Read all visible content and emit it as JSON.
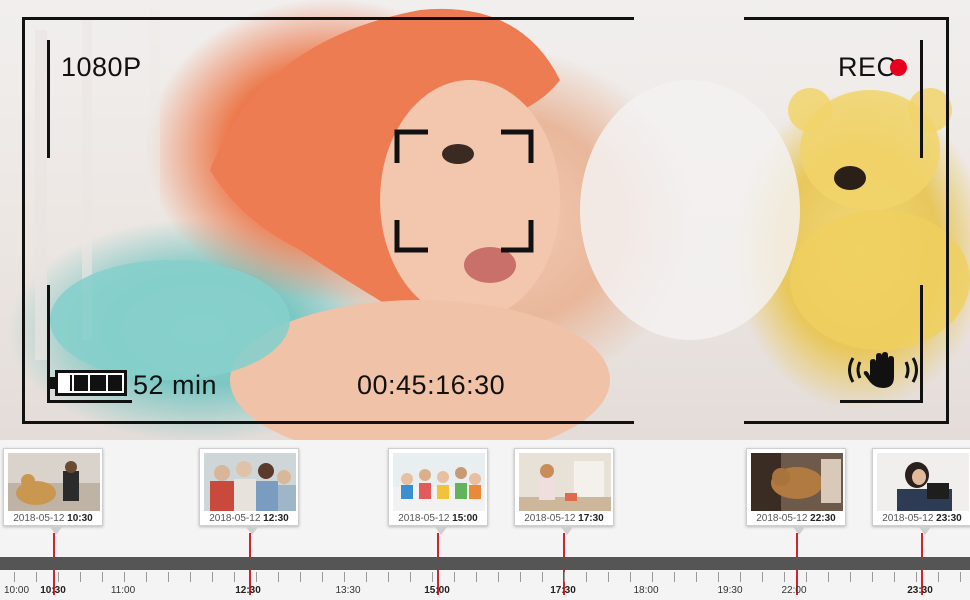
{
  "hud": {
    "resolution": "1080P",
    "rec_label": "REC",
    "battery_time": "52 min",
    "timecode": "00:45:16:30",
    "rec_color": "#e6001e"
  },
  "events": [
    {
      "date": "2018-05-12",
      "time": "10:30",
      "scene": "girl-with-dog"
    },
    {
      "date": "2018-05-12",
      "time": "12:30",
      "scene": "family-group"
    },
    {
      "date": "2018-05-12",
      "time": "15:00",
      "scene": "kids-at-table"
    },
    {
      "date": "2018-05-12",
      "time": "17:30",
      "scene": "child-playing"
    },
    {
      "date": "2018-05-12",
      "time": "22:30",
      "scene": "dog-on-floor"
    },
    {
      "date": "2018-05-12",
      "time": "23:30",
      "scene": "woman-with-tablet"
    }
  ],
  "axis_labels": [
    "10:00",
    "10:30",
    "11:00",
    "12:30",
    "13:30",
    "15:00",
    "17:30",
    "18:00",
    "19:30",
    "22:00",
    "23:30"
  ],
  "colors": {
    "marker": "#d0232b",
    "track": "#555555"
  }
}
